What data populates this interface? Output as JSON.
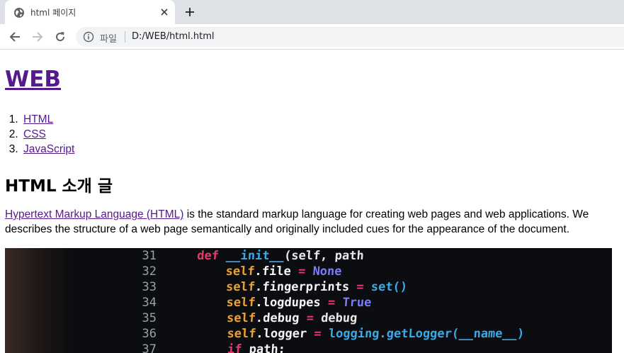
{
  "browser": {
    "tab_title": "html 페이지",
    "address_scheme_label": "파일",
    "address_url": "D:/WEB/html.html"
  },
  "page": {
    "heading": "WEB",
    "nav": [
      {
        "label": "HTML"
      },
      {
        "label": "CSS"
      },
      {
        "label": "JavaScript"
      }
    ],
    "section_title": "HTML 소개 글",
    "intro_link": "Hypertext Markup Language (HTML)",
    "intro_line1_rest": " is the standard markup language for creating web pages and web applications. We",
    "intro_line2": "describes the structure of a web page semantically and originally included cues for the appearance of the document.",
    "image": {
      "line_numbers": [
        "31",
        "32",
        "33",
        "34",
        "35",
        "36",
        "37"
      ],
      "code_lines": [
        {
          "a": "def ",
          "b": "__init__",
          "c": "(self, path",
          "d": ""
        },
        {
          "a": "self",
          "b": ".file ",
          "c": "= ",
          "d": "None"
        },
        {
          "a": "self",
          "b": ".fingerprints ",
          "c": "= ",
          "d": "set()"
        },
        {
          "a": "self",
          "b": ".logdupes ",
          "c": "= ",
          "d": "True"
        },
        {
          "a": "self",
          "b": ".debug ",
          "c": "= ",
          "d": "debug"
        },
        {
          "a": "self",
          "b": ".logger ",
          "c": "= ",
          "d": "logging.getLogger(__name__)"
        },
        {
          "a": "if ",
          "b": "path:",
          "c": "",
          "d": ""
        }
      ]
    }
  }
}
